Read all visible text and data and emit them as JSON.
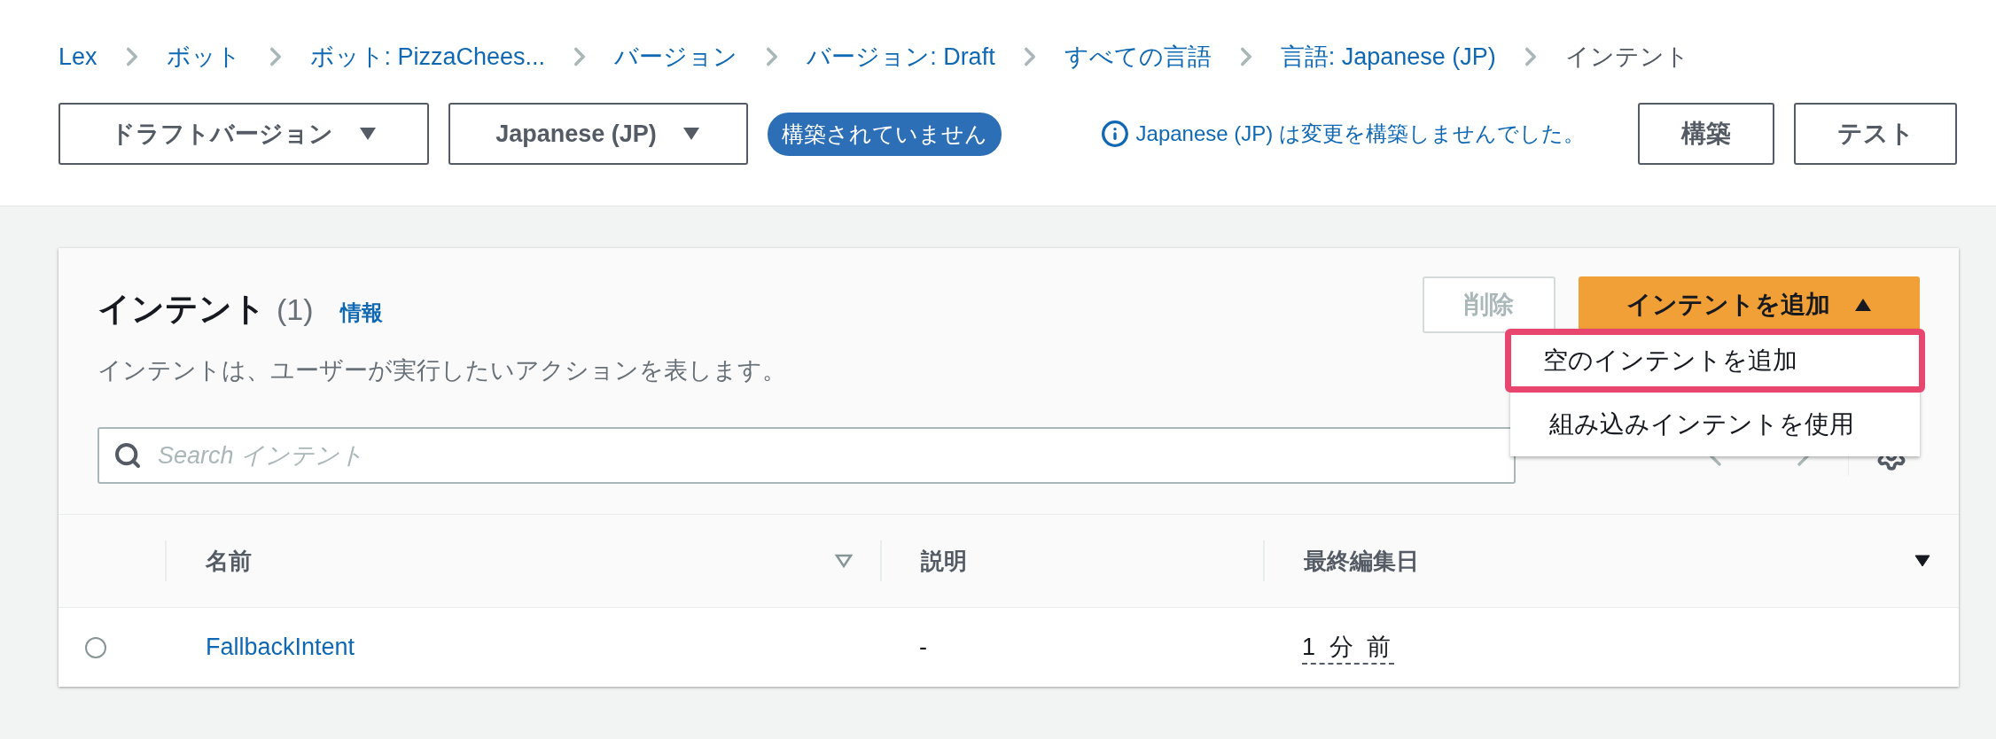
{
  "breadcrumbs": [
    {
      "label": "Lex",
      "current": false
    },
    {
      "label": "ボット",
      "current": false
    },
    {
      "label": "ボット: PizzaChees...",
      "current": false
    },
    {
      "label": "バージョン",
      "current": false
    },
    {
      "label": "バージョン: Draft",
      "current": false
    },
    {
      "label": "すべての言語",
      "current": false
    },
    {
      "label": "言語: Japanese (JP)",
      "current": false
    },
    {
      "label": "インテント",
      "current": true
    }
  ],
  "toolbar": {
    "version_select": "ドラフトバージョン",
    "language_select": "Japanese (JP)",
    "status_badge": "構築されていません",
    "info_message": "Japanese (JP) は変更を構築しませんでした。",
    "buttons": [
      "構築",
      "テスト"
    ]
  },
  "panel": {
    "title": "インテント",
    "count": "(1)",
    "info_link": "情報",
    "description": "インテントは、ユーザーが実行したいアクションを表します。",
    "delete_button": {
      "label": "削除",
      "disabled": true
    },
    "add_button": {
      "label": "インテントを追加",
      "expanded": true
    },
    "add_menu": [
      {
        "label": "空のインテントを追加",
        "selected": true
      },
      {
        "label": "組み込みインテントを使用",
        "selected": false
      }
    ],
    "search": {
      "placeholder": "Search インテント"
    },
    "table": {
      "columns": [
        {
          "label": "名前",
          "sorted": false
        },
        {
          "label": "説明"
        },
        {
          "label": "最終編集日",
          "sorted": true
        }
      ],
      "rows": [
        {
          "selected": false,
          "name": "FallbackIntent",
          "description": "-",
          "last_edited": "1 分 前"
        }
      ]
    }
  }
}
